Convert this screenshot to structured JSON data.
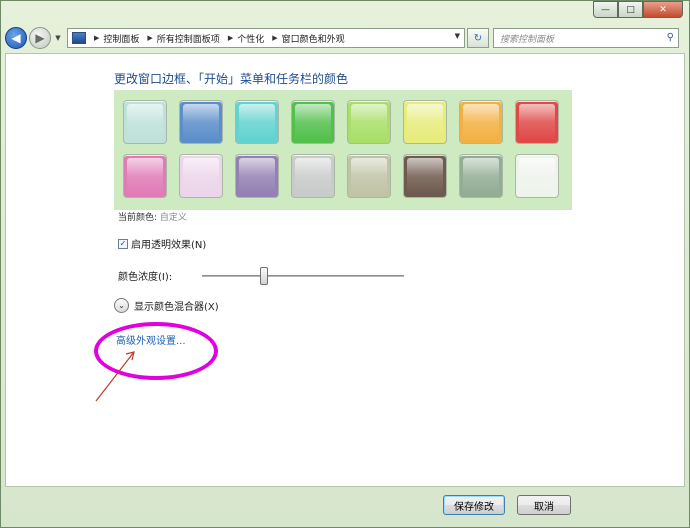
{
  "window": {
    "caption_buttons": [
      "minimize",
      "maximize",
      "close"
    ]
  },
  "nav": {
    "breadcrumbs": [
      "控制面板",
      "所有控制面板项",
      "个性化",
      "窗口颜色和外观"
    ],
    "search_placeholder": "搜索控制面板"
  },
  "main": {
    "title": "更改窗口边框、「开始」菜单和任务栏的颜色",
    "swatches": [
      {
        "color": "#bfe1da"
      },
      {
        "color": "#5c8ec9"
      },
      {
        "color": "#62d3d0"
      },
      {
        "color": "#53c04c"
      },
      {
        "color": "#a9df68"
      },
      {
        "color": "#e7ec7b"
      },
      {
        "color": "#f3b144"
      },
      {
        "color": "#df4a48"
      },
      {
        "color": "#e07bb6"
      },
      {
        "color": "#ecd5ea"
      },
      {
        "color": "#9480b3"
      },
      {
        "color": "#c8cbc9"
      },
      {
        "color": "#c0c4a6"
      },
      {
        "color": "#6e5a4e"
      },
      {
        "color": "#92ad94"
      },
      {
        "color": "#eef3ec"
      }
    ],
    "current_color_label": "当前颜色:",
    "current_color_value": "自定义",
    "transparency_label": "启用透明效果(N)",
    "transparency_checked": true,
    "intensity_label": "颜色浓度(I):",
    "intensity_value": 0.3,
    "mixer_label": "显示颜色混合器(X)",
    "advanced_link": "高级外观设置..."
  },
  "footer": {
    "save_label": "保存修改",
    "cancel_label": "取消"
  },
  "colors": {
    "link": "#1e5fbd",
    "title": "#1f4d8f",
    "swatch_panel_bg": "#cdeac1",
    "annotation": "#e000e0"
  }
}
